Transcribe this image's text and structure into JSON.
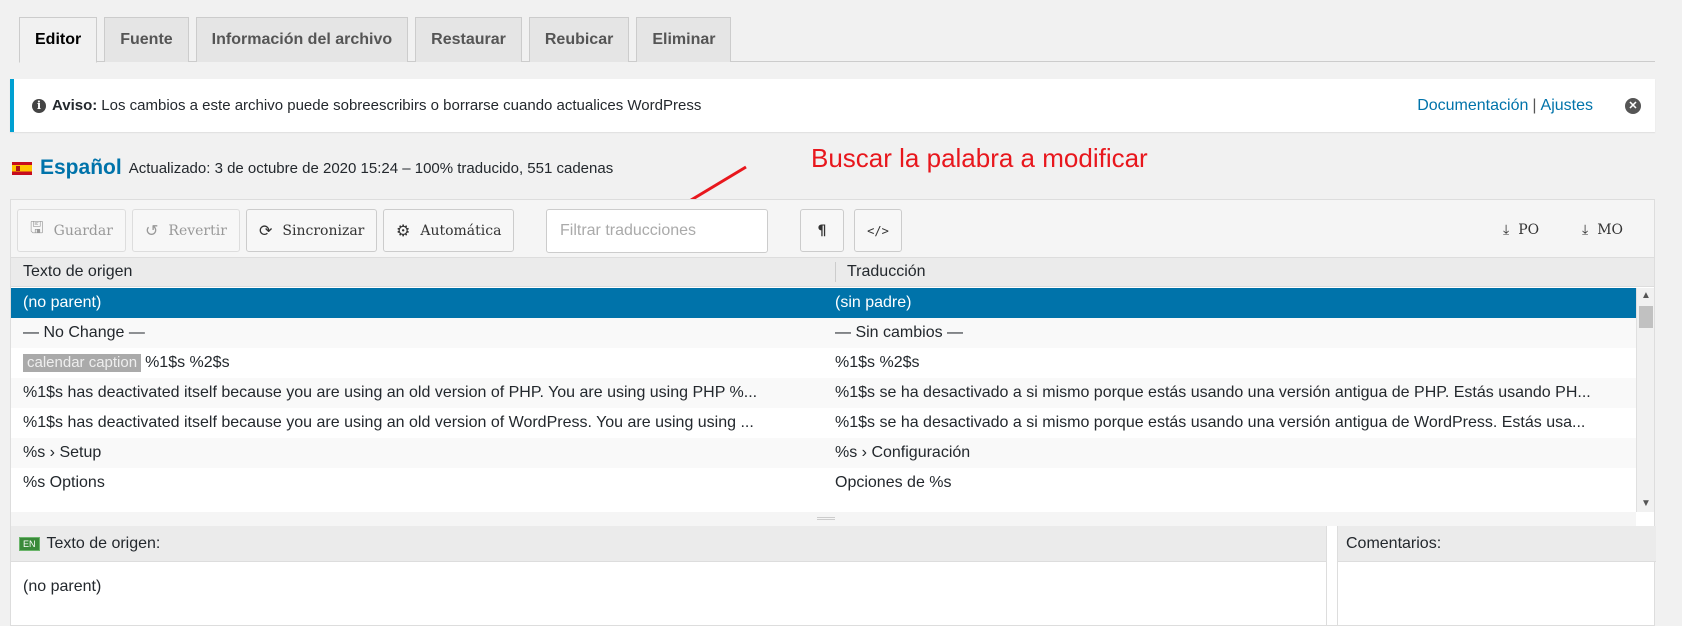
{
  "tabs": [
    {
      "label": "Editor",
      "active": true
    },
    {
      "label": "Fuente",
      "active": false
    },
    {
      "label": "Información del archivo",
      "active": false
    },
    {
      "label": "Restaurar",
      "active": false
    },
    {
      "label": "Reubicar",
      "active": false
    },
    {
      "label": "Eliminar",
      "active": false
    }
  ],
  "notice": {
    "label": "Aviso:",
    "text": "Los cambios a este archivo puede sobreescribirs o borrarse cuando actualices WordPress",
    "link_docs": "Documentación",
    "separator": "|",
    "link_settings": "Ajustes"
  },
  "locale": {
    "language": "Español",
    "meta": "Actualizado: 3 de octubre de 2020 15:24 – 100% traducido, 551 cadenas"
  },
  "annotation": {
    "text": "Buscar la palabra a modificar",
    "color": "#e8171d"
  },
  "toolbar": {
    "save_label": "Guardar",
    "revert_label": "Revertir",
    "sync_label": "Sincronizar",
    "auto_label": "Automática",
    "filter_placeholder": "Filtrar traducciones",
    "po_label": "PO",
    "mo_label": "MO"
  },
  "grid": {
    "source_header": "Texto de origen",
    "translation_header": "Traducción",
    "rows": [
      {
        "context": "",
        "source": "(no parent)",
        "translation": "(sin padre)",
        "selected": true
      },
      {
        "context": "",
        "source": "— No Change —",
        "translation": "— Sin cambios —",
        "selected": false
      },
      {
        "context": "calendar caption",
        "source": "%1$s %2$s",
        "translation": "%1$s %2$s",
        "selected": false
      },
      {
        "context": "",
        "source": "%1$s has deactivated itself because you are using an old version of PHP. You are using using PHP %...",
        "translation": "%1$s se ha desactivado a si mismo porque estás usando una versión antigua de PHP. Estás usando PH...",
        "selected": false
      },
      {
        "context": "",
        "source": "%1$s has deactivated itself because you are using an old version of WordPress. You are using using ...",
        "translation": "%1$s se ha desactivado a si mismo porque estás usando una versión antigua de WordPress. Estás usa...",
        "selected": false
      },
      {
        "context": "",
        "source": "%s › Setup",
        "translation": "%s › Configuración",
        "selected": false
      },
      {
        "context": "",
        "source": "%s Options",
        "translation": "Opciones de %s",
        "selected": false
      }
    ]
  },
  "source_pane": {
    "badge": "EN",
    "title": "Texto de origen:",
    "text": "(no parent)"
  },
  "comments_pane": {
    "title": "Comentarios:"
  },
  "colors": {
    "accent": "#0073aa",
    "notice_border": "#00a0d2"
  }
}
